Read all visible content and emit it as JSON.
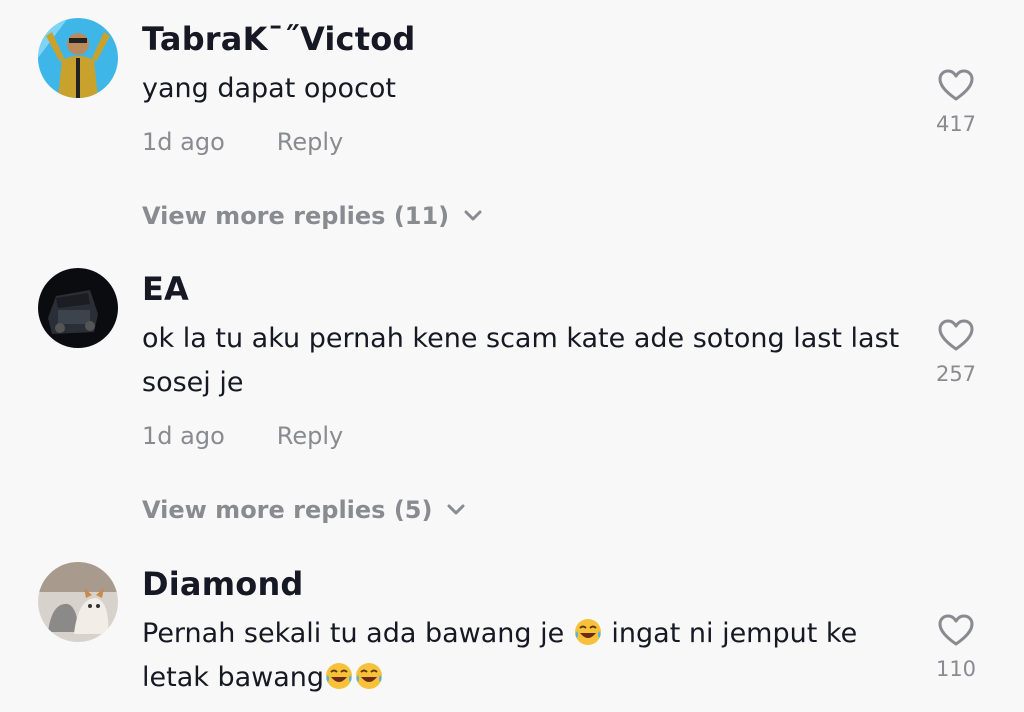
{
  "comments": [
    {
      "username": "TabraK¯˝Victod",
      "text": "yang dapat opocot",
      "time": "1d ago",
      "reply_label": "Reply",
      "likes": "417",
      "view_more": "View more replies (11)"
    },
    {
      "username": "EA",
      "text": "ok la tu aku pernah kene scam kate ade sotong last last sosej je",
      "time": "1d ago",
      "reply_label": "Reply",
      "likes": "257",
      "view_more": "View more replies (5)"
    },
    {
      "username": "Diamond",
      "text_part1": "Pernah sekali tu ada bawang je ",
      "text_part2": " ingat ni jemput ke letak bawang",
      "likes": "110"
    }
  ],
  "colors": {
    "background": "#f8f8f8",
    "primary_text": "#161823",
    "secondary_text": "#8a8b91"
  },
  "icons": [
    "heart-icon",
    "chevron-down-icon",
    "laughing-emoji-icon"
  ]
}
